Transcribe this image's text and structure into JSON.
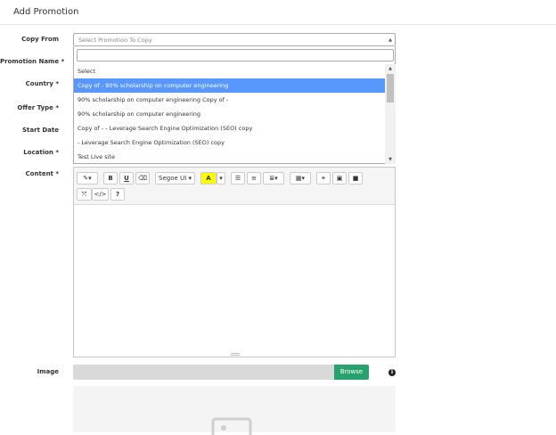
{
  "page": {
    "title": "Add Promotion"
  },
  "form": {
    "copy_from_label": "Copy From",
    "promotion_name_label": "Promotion Name *",
    "country_label": "Country *",
    "offer_type_label": "Offer Type *",
    "start_date_label": "Start Date",
    "location_label": "Location *",
    "content_label": "Content *",
    "image_label": "Image"
  },
  "copy_select": {
    "placeholder": "Select Promotion To Copy",
    "search_value": "",
    "options": [
      "Select",
      "Copy of - 90% scholarship on computer engineering",
      "90% scholarship on computer engineering Copy of -",
      "90% scholarship on computer engineering",
      "Copy of - - Leverage Search Engine Optimization (SEO) copy",
      "- Leverage Search Engine Optimization (SEO) copy",
      "Test Live site"
    ],
    "highlighted_index": 1
  },
  "editor": {
    "font_name": "Segoe UI",
    "bold_label": "B",
    "underline_label": "U",
    "color_label": "A",
    "code_label": "</>",
    "help_label": "?"
  },
  "image_upload": {
    "browse_label": "Browse",
    "info_symbol": "i"
  },
  "colors": {
    "highlight": "#5897fb",
    "browse": "#27a26e",
    "color_swatch": "#ffff00"
  }
}
